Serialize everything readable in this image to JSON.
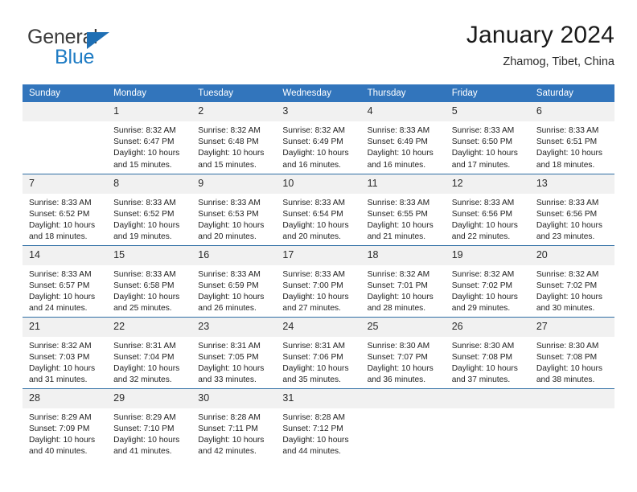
{
  "logo": {
    "word_top": "General",
    "word_bottom": "Blue",
    "triangle_icon": "blue-triangle-icon",
    "accent_color": "#1f7cc4"
  },
  "header": {
    "title": "January 2024",
    "subtitle": "Zhamog, Tibet, China"
  },
  "theme": {
    "header_bg": "#3275bc",
    "row_line": "#2e6da4",
    "daynum_bg": "#f1f1f1"
  },
  "weekday_headers": [
    "Sunday",
    "Monday",
    "Tuesday",
    "Wednesday",
    "Thursday",
    "Friday",
    "Saturday"
  ],
  "weeks": [
    [
      {
        "day": "",
        "sunrise": "",
        "sunset": "",
        "daylight_a": "",
        "daylight_b": ""
      },
      {
        "day": "1",
        "sunrise": "Sunrise: 8:32 AM",
        "sunset": "Sunset: 6:47 PM",
        "daylight_a": "Daylight: 10 hours",
        "daylight_b": "and 15 minutes."
      },
      {
        "day": "2",
        "sunrise": "Sunrise: 8:32 AM",
        "sunset": "Sunset: 6:48 PM",
        "daylight_a": "Daylight: 10 hours",
        "daylight_b": "and 15 minutes."
      },
      {
        "day": "3",
        "sunrise": "Sunrise: 8:32 AM",
        "sunset": "Sunset: 6:49 PM",
        "daylight_a": "Daylight: 10 hours",
        "daylight_b": "and 16 minutes."
      },
      {
        "day": "4",
        "sunrise": "Sunrise: 8:33 AM",
        "sunset": "Sunset: 6:49 PM",
        "daylight_a": "Daylight: 10 hours",
        "daylight_b": "and 16 minutes."
      },
      {
        "day": "5",
        "sunrise": "Sunrise: 8:33 AM",
        "sunset": "Sunset: 6:50 PM",
        "daylight_a": "Daylight: 10 hours",
        "daylight_b": "and 17 minutes."
      },
      {
        "day": "6",
        "sunrise": "Sunrise: 8:33 AM",
        "sunset": "Sunset: 6:51 PM",
        "daylight_a": "Daylight: 10 hours",
        "daylight_b": "and 18 minutes."
      }
    ],
    [
      {
        "day": "7",
        "sunrise": "Sunrise: 8:33 AM",
        "sunset": "Sunset: 6:52 PM",
        "daylight_a": "Daylight: 10 hours",
        "daylight_b": "and 18 minutes."
      },
      {
        "day": "8",
        "sunrise": "Sunrise: 8:33 AM",
        "sunset": "Sunset: 6:52 PM",
        "daylight_a": "Daylight: 10 hours",
        "daylight_b": "and 19 minutes."
      },
      {
        "day": "9",
        "sunrise": "Sunrise: 8:33 AM",
        "sunset": "Sunset: 6:53 PM",
        "daylight_a": "Daylight: 10 hours",
        "daylight_b": "and 20 minutes."
      },
      {
        "day": "10",
        "sunrise": "Sunrise: 8:33 AM",
        "sunset": "Sunset: 6:54 PM",
        "daylight_a": "Daylight: 10 hours",
        "daylight_b": "and 20 minutes."
      },
      {
        "day": "11",
        "sunrise": "Sunrise: 8:33 AM",
        "sunset": "Sunset: 6:55 PM",
        "daylight_a": "Daylight: 10 hours",
        "daylight_b": "and 21 minutes."
      },
      {
        "day": "12",
        "sunrise": "Sunrise: 8:33 AM",
        "sunset": "Sunset: 6:56 PM",
        "daylight_a": "Daylight: 10 hours",
        "daylight_b": "and 22 minutes."
      },
      {
        "day": "13",
        "sunrise": "Sunrise: 8:33 AM",
        "sunset": "Sunset: 6:56 PM",
        "daylight_a": "Daylight: 10 hours",
        "daylight_b": "and 23 minutes."
      }
    ],
    [
      {
        "day": "14",
        "sunrise": "Sunrise: 8:33 AM",
        "sunset": "Sunset: 6:57 PM",
        "daylight_a": "Daylight: 10 hours",
        "daylight_b": "and 24 minutes."
      },
      {
        "day": "15",
        "sunrise": "Sunrise: 8:33 AM",
        "sunset": "Sunset: 6:58 PM",
        "daylight_a": "Daylight: 10 hours",
        "daylight_b": "and 25 minutes."
      },
      {
        "day": "16",
        "sunrise": "Sunrise: 8:33 AM",
        "sunset": "Sunset: 6:59 PM",
        "daylight_a": "Daylight: 10 hours",
        "daylight_b": "and 26 minutes."
      },
      {
        "day": "17",
        "sunrise": "Sunrise: 8:33 AM",
        "sunset": "Sunset: 7:00 PM",
        "daylight_a": "Daylight: 10 hours",
        "daylight_b": "and 27 minutes."
      },
      {
        "day": "18",
        "sunrise": "Sunrise: 8:32 AM",
        "sunset": "Sunset: 7:01 PM",
        "daylight_a": "Daylight: 10 hours",
        "daylight_b": "and 28 minutes."
      },
      {
        "day": "19",
        "sunrise": "Sunrise: 8:32 AM",
        "sunset": "Sunset: 7:02 PM",
        "daylight_a": "Daylight: 10 hours",
        "daylight_b": "and 29 minutes."
      },
      {
        "day": "20",
        "sunrise": "Sunrise: 8:32 AM",
        "sunset": "Sunset: 7:02 PM",
        "daylight_a": "Daylight: 10 hours",
        "daylight_b": "and 30 minutes."
      }
    ],
    [
      {
        "day": "21",
        "sunrise": "Sunrise: 8:32 AM",
        "sunset": "Sunset: 7:03 PM",
        "daylight_a": "Daylight: 10 hours",
        "daylight_b": "and 31 minutes."
      },
      {
        "day": "22",
        "sunrise": "Sunrise: 8:31 AM",
        "sunset": "Sunset: 7:04 PM",
        "daylight_a": "Daylight: 10 hours",
        "daylight_b": "and 32 minutes."
      },
      {
        "day": "23",
        "sunrise": "Sunrise: 8:31 AM",
        "sunset": "Sunset: 7:05 PM",
        "daylight_a": "Daylight: 10 hours",
        "daylight_b": "and 33 minutes."
      },
      {
        "day": "24",
        "sunrise": "Sunrise: 8:31 AM",
        "sunset": "Sunset: 7:06 PM",
        "daylight_a": "Daylight: 10 hours",
        "daylight_b": "and 35 minutes."
      },
      {
        "day": "25",
        "sunrise": "Sunrise: 8:30 AM",
        "sunset": "Sunset: 7:07 PM",
        "daylight_a": "Daylight: 10 hours",
        "daylight_b": "and 36 minutes."
      },
      {
        "day": "26",
        "sunrise": "Sunrise: 8:30 AM",
        "sunset": "Sunset: 7:08 PM",
        "daylight_a": "Daylight: 10 hours",
        "daylight_b": "and 37 minutes."
      },
      {
        "day": "27",
        "sunrise": "Sunrise: 8:30 AM",
        "sunset": "Sunset: 7:08 PM",
        "daylight_a": "Daylight: 10 hours",
        "daylight_b": "and 38 minutes."
      }
    ],
    [
      {
        "day": "28",
        "sunrise": "Sunrise: 8:29 AM",
        "sunset": "Sunset: 7:09 PM",
        "daylight_a": "Daylight: 10 hours",
        "daylight_b": "and 40 minutes."
      },
      {
        "day": "29",
        "sunrise": "Sunrise: 8:29 AM",
        "sunset": "Sunset: 7:10 PM",
        "daylight_a": "Daylight: 10 hours",
        "daylight_b": "and 41 minutes."
      },
      {
        "day": "30",
        "sunrise": "Sunrise: 8:28 AM",
        "sunset": "Sunset: 7:11 PM",
        "daylight_a": "Daylight: 10 hours",
        "daylight_b": "and 42 minutes."
      },
      {
        "day": "31",
        "sunrise": "Sunrise: 8:28 AM",
        "sunset": "Sunset: 7:12 PM",
        "daylight_a": "Daylight: 10 hours",
        "daylight_b": "and 44 minutes."
      },
      {
        "day": "",
        "sunrise": "",
        "sunset": "",
        "daylight_a": "",
        "daylight_b": ""
      },
      {
        "day": "",
        "sunrise": "",
        "sunset": "",
        "daylight_a": "",
        "daylight_b": ""
      },
      {
        "day": "",
        "sunrise": "",
        "sunset": "",
        "daylight_a": "",
        "daylight_b": ""
      }
    ]
  ]
}
